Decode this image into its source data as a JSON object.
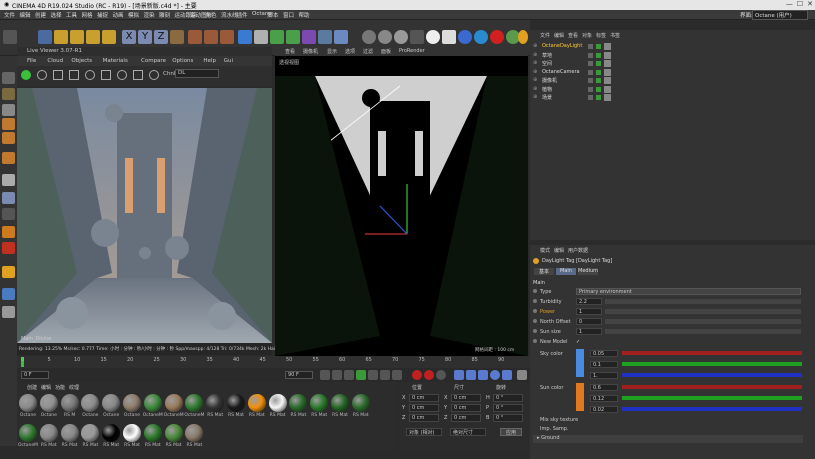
{
  "titlebar": {
    "title": "CINEMA 4D R19.024 Studio (RC - R19) - [场景新版.c4d *] - 主要",
    "minimize": "—",
    "maximize": "☐",
    "close": "✕"
  },
  "menubar": [
    "文件",
    "编辑",
    "创建",
    "选择",
    "工具",
    "网格",
    "捕捉",
    "动画",
    "模拟",
    "渲染",
    "雕刻",
    "运动跟踪",
    "运动图形",
    "角色",
    "流水线",
    "插件",
    "Octane",
    "脚本",
    "窗口",
    "帮助"
  ],
  "layout_label": "界面:",
  "layout_value": "Octane (用户)",
  "live_viewer": {
    "title": "Live Viewer 3.07-R1",
    "menu": [
      "File",
      "Cloud",
      "Objects",
      "Materials",
      "Compare",
      "Options",
      "Help",
      "Gui"
    ],
    "channel_label": "Chnl:",
    "channel_value": "DL",
    "status_line": "Rendering: 13.25% Ms/sec: 0.777   Time: 小时 : 分钟 : 秒/小时 : 分钟 : 秒   Spp/maxspp: 4/128   Tri: 0/734k   Mesh: 2k   Hair"
  },
  "viewport": {
    "tabs": [
      "查看",
      "摄像机",
      "显示",
      "选项",
      "过滤",
      "面板",
      "ProRender"
    ],
    "label": "透视视图",
    "grid_info": "网格间距 : 100 cm"
  },
  "timeline": {
    "ticks": [
      "0",
      "5",
      "10",
      "15",
      "20",
      "25",
      "30",
      "35",
      "40",
      "45",
      "50",
      "55",
      "60",
      "65",
      "70",
      "75",
      "80",
      "85",
      "90"
    ],
    "frame_field": "0 F",
    "start_field": "0 F",
    "end_field": "90 F",
    "end_field2": "90 F",
    "current": "0 F"
  },
  "materials": {
    "menu": [
      "创建",
      "编辑",
      "功能",
      "纹理"
    ],
    "row1": [
      {
        "label": "Octane",
        "color": "#8a8a8a"
      },
      {
        "label": "Octane",
        "color": "#909090"
      },
      {
        "label": "RS M",
        "color": "#777"
      },
      {
        "label": "Octane",
        "color": "#8c8c8c"
      },
      {
        "label": "Octane",
        "color": "#888"
      },
      {
        "label": "Octane",
        "color": "#8e7c6a"
      },
      {
        "label": "OctaneM",
        "color": "#3a8a3a"
      },
      {
        "label": "OctaneM",
        "color": "#9a7a5a"
      },
      {
        "label": "OctaneM",
        "color": "#2f7a2f"
      },
      {
        "label": "RS Mat",
        "color": "#333"
      },
      {
        "label": "RS Mat",
        "color": "#1a1a1a"
      },
      {
        "label": "RS Mat",
        "color": "#f0900a"
      },
      {
        "label": "RS Mat",
        "color": "#f5f5f5"
      },
      {
        "label": "RS Mat",
        "color": "#2a6a2a"
      },
      {
        "label": "RS Mat",
        "color": "#2a7a2a"
      },
      {
        "label": "RS Mat",
        "color": "#246624"
      },
      {
        "label": "RS Mat",
        "color": "#2a6a2a"
      }
    ],
    "row2": [
      {
        "label": "OctaneM",
        "color": "#2f7a2f"
      },
      {
        "label": "RS Mat",
        "color": "#888"
      },
      {
        "label": "RS Mat",
        "color": "#888"
      },
      {
        "label": "RS Mat",
        "color": "#999"
      },
      {
        "label": "RS Mat",
        "color": "#000"
      },
      {
        "label": "RS Mat",
        "color": "#ffffff"
      },
      {
        "label": "RS Mat",
        "color": "#2a7a2a"
      },
      {
        "label": "RS Mat",
        "color": "#4a8a3a"
      },
      {
        "label": "RS Mat",
        "color": "#8a7a6a"
      }
    ]
  },
  "coords": {
    "headers": [
      "位置",
      "尺寸",
      "旋转"
    ],
    "rows": [
      [
        "X",
        "0 cm",
        "X",
        "0 cm",
        "H",
        "0 °"
      ],
      [
        "Y",
        "0 cm",
        "Y",
        "0 cm",
        "P",
        "0 °"
      ],
      [
        "Z",
        "0 cm",
        "Z",
        "0 cm",
        "B",
        "0 °"
      ]
    ],
    "mode": "对象 (相对)",
    "size_mode": "绝对尺寸",
    "apply": "应用"
  },
  "objects": {
    "menu": [
      "文件",
      "编辑",
      "查看",
      "对象",
      "标签",
      "书签"
    ],
    "items": [
      {
        "name": "OctaneDayLight",
        "color": "#ffcc33"
      },
      {
        "name": "草地",
        "color": "#ddd"
      },
      {
        "name": "空间",
        "color": "#ddd"
      },
      {
        "name": "OctaneCamera",
        "color": "#ddd"
      },
      {
        "name": "摄像机",
        "color": "#ddd"
      },
      {
        "name": "植物",
        "color": "#ddd"
      },
      {
        "name": "场景",
        "color": "#ddd"
      }
    ]
  },
  "attributes": {
    "menu": [
      "模式",
      "编辑",
      "用户数据"
    ],
    "title": "DayLight Tag [DayLight Tag]",
    "tabs": [
      "基本",
      "Main",
      "Medium"
    ],
    "section": "Main",
    "rows": [
      {
        "label": "Type",
        "value": "Primary environment"
      },
      {
        "label": "Turbidity",
        "value": "2.2"
      },
      {
        "label": "Power",
        "value": "1"
      },
      {
        "label": "North Offset",
        "value": "0"
      },
      {
        "label": "Sun size",
        "value": "1"
      },
      {
        "label": "New Model",
        "value": "✓"
      }
    ],
    "sky_color_label": "Sky color",
    "sky_color_values": [
      "0.05",
      "0.1",
      "1."
    ],
    "sun_color_label": "Sun color",
    "sun_color_values": [
      "0.6",
      "0.12",
      "0.02"
    ],
    "mix_label": "Mix sky texture",
    "imp_label": "Imp. Samp.",
    "ground": "Ground"
  }
}
